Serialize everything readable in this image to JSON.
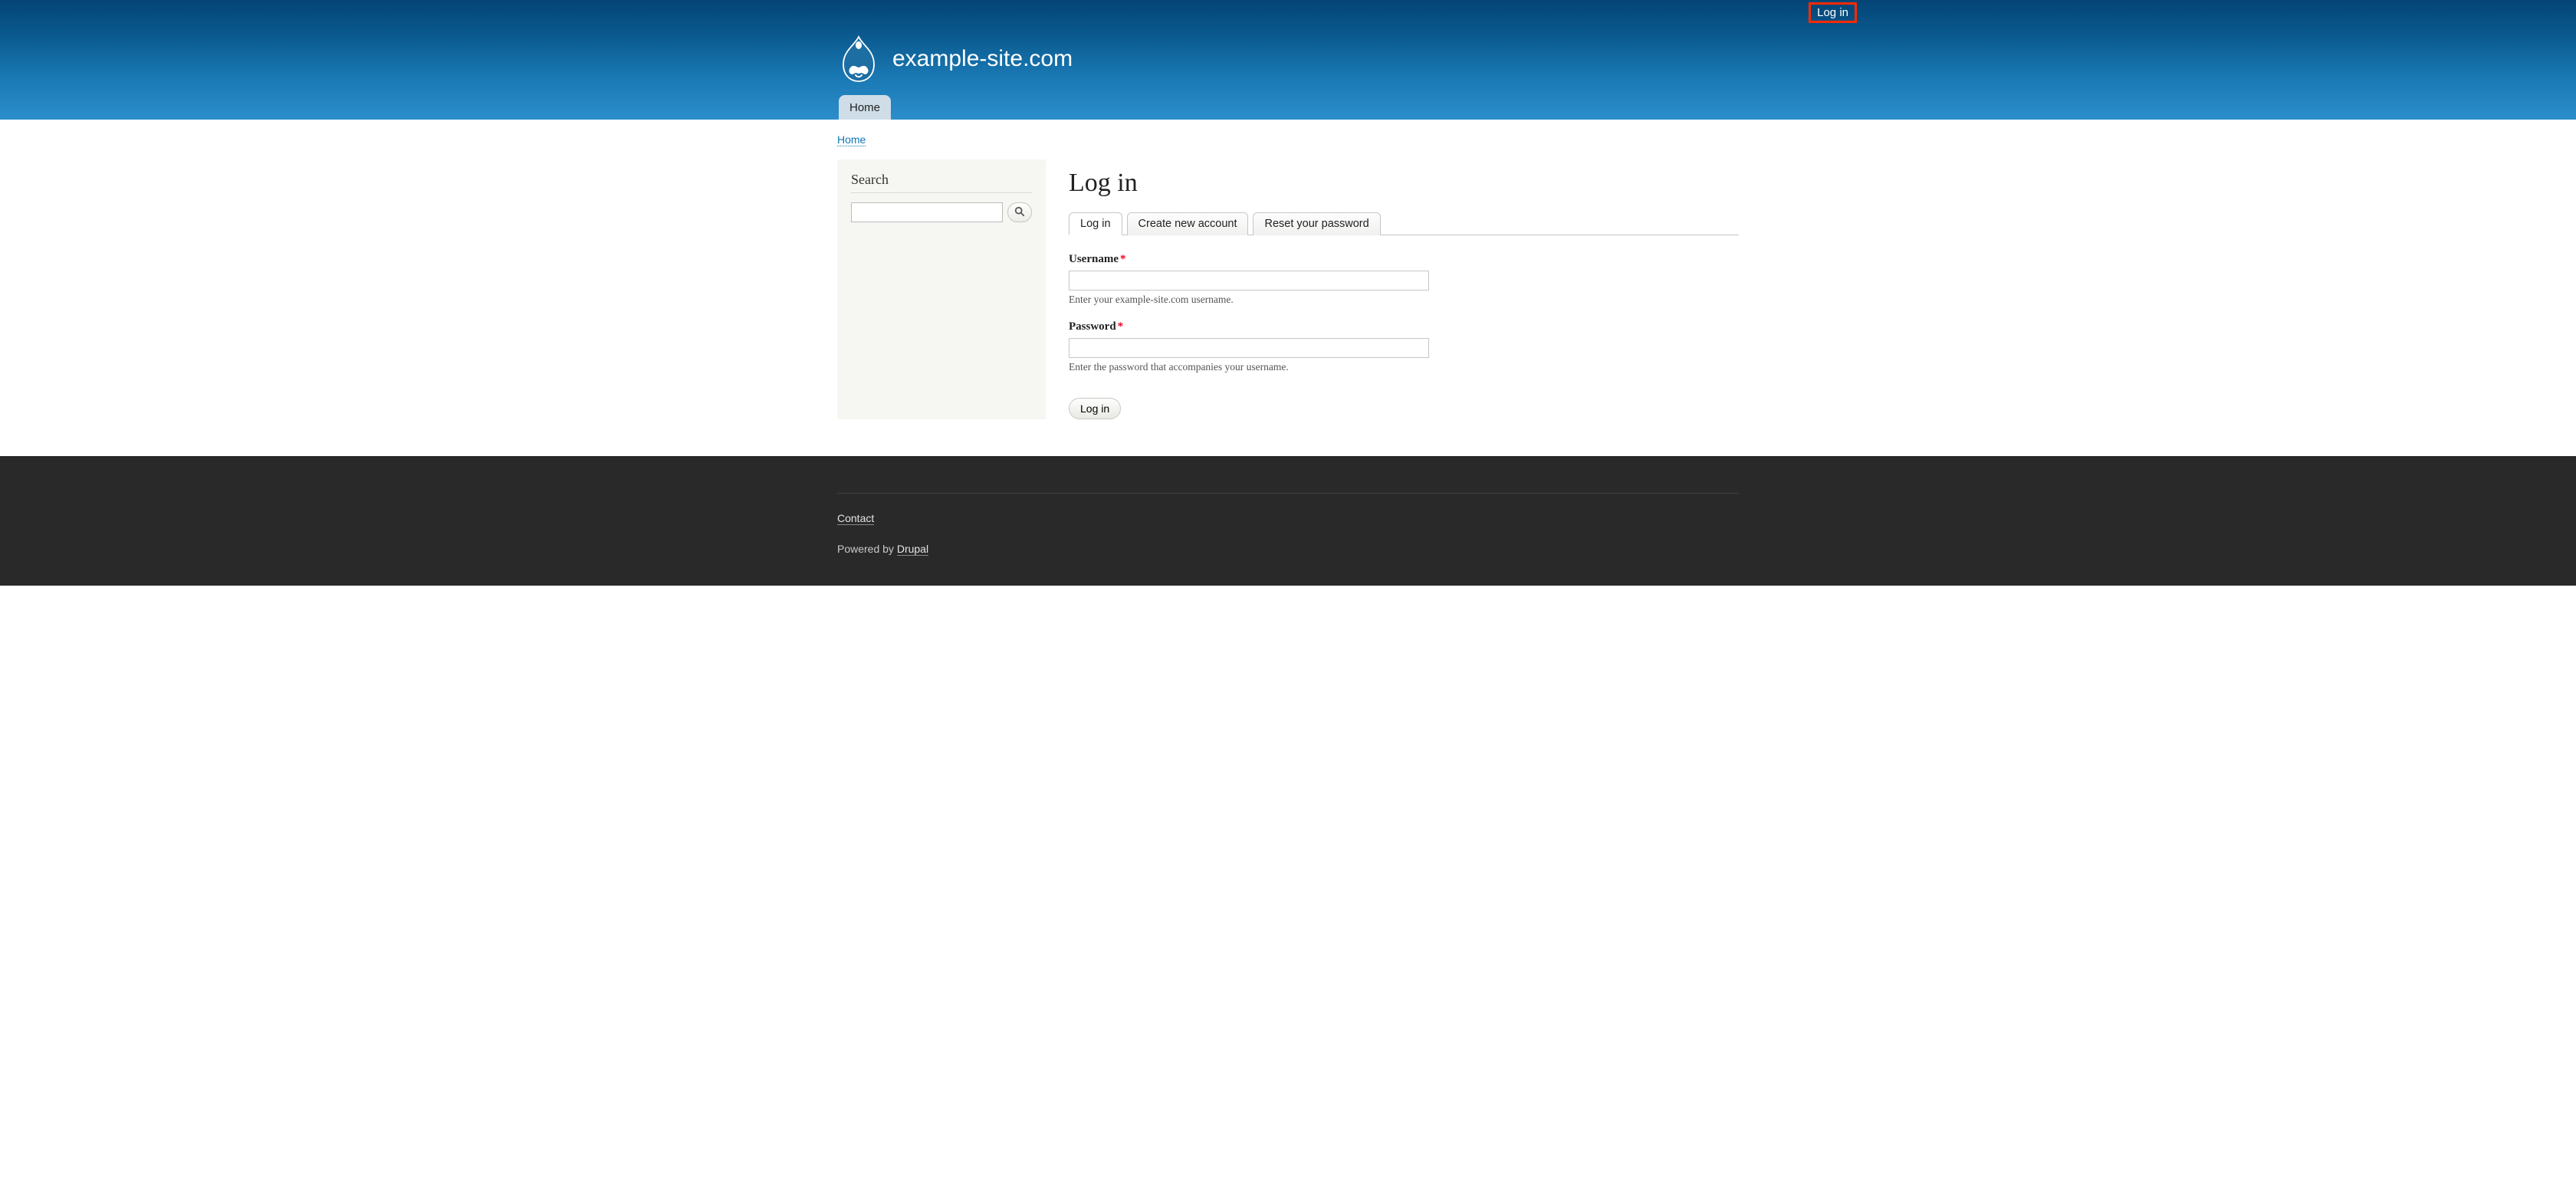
{
  "top_login": "Log in",
  "site_name": "example-site.com",
  "nav_home": "Home",
  "breadcrumb_home": "Home",
  "sidebar": {
    "search_heading": "Search"
  },
  "page_title": "Log in",
  "tabs": {
    "login": "Log in",
    "create": "Create new account",
    "reset": "Reset your password"
  },
  "form": {
    "username_label": "Username",
    "username_value": "",
    "username_desc": "Enter your example-site.com username.",
    "password_label": "Password",
    "password_value": "",
    "password_desc": "Enter the password that accompanies your username.",
    "submit": "Log in"
  },
  "footer": {
    "contact": "Contact",
    "powered_by_prefix": "Powered by ",
    "powered_by_link": "Drupal"
  }
}
